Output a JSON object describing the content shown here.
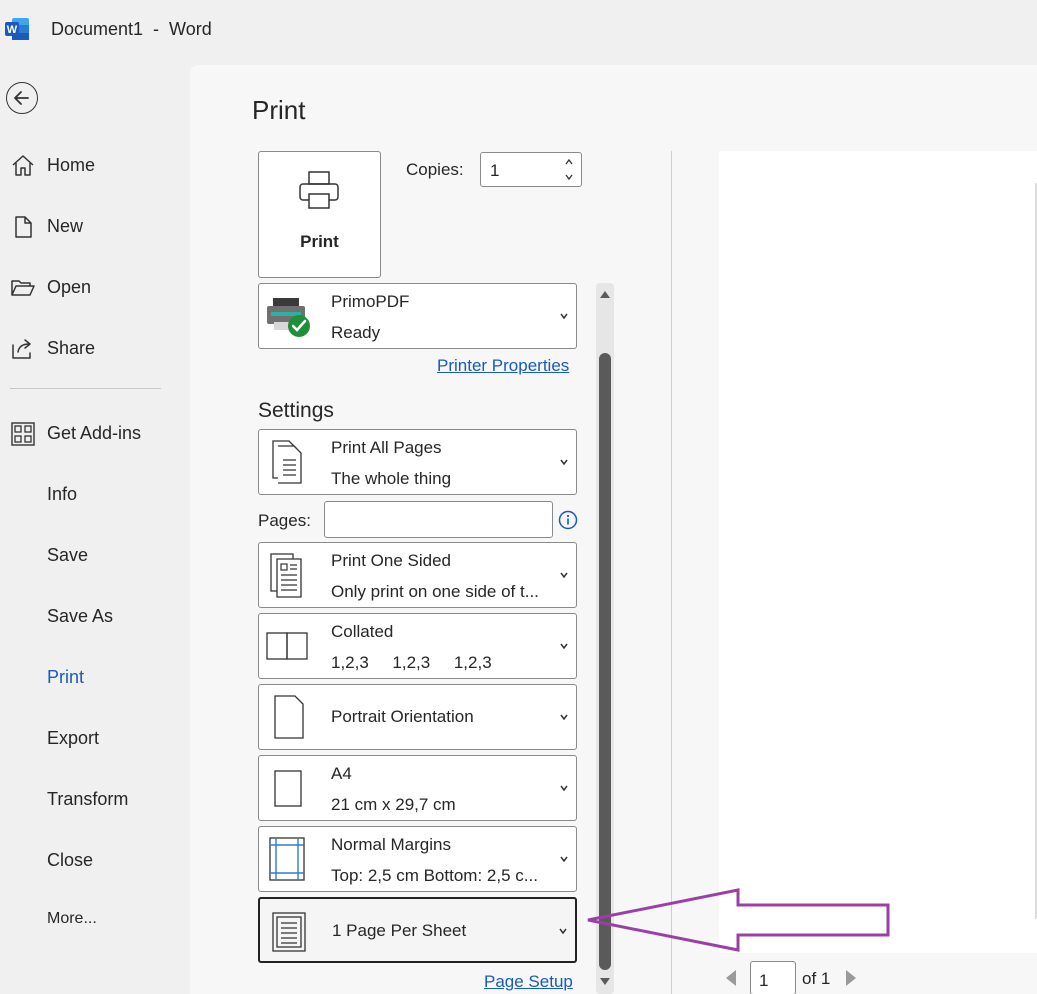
{
  "titlebar": {
    "title": "Document1  -  Word",
    "logo_letter": "W"
  },
  "nav": {
    "back_icon": "back-arrow-icon",
    "items": [
      {
        "label": "Home",
        "icon": "home-icon"
      },
      {
        "label": "New",
        "icon": "new-document-icon"
      },
      {
        "label": "Open",
        "icon": "folder-open-icon"
      },
      {
        "label": "Share",
        "icon": "share-icon"
      },
      {
        "label": "Get Add-ins",
        "icon": "add-ins-grid-icon"
      },
      {
        "label": "Info"
      },
      {
        "label": "Save"
      },
      {
        "label": "Save As"
      },
      {
        "label": "Print",
        "active": true
      },
      {
        "label": "Export"
      },
      {
        "label": "Transform"
      },
      {
        "label": "Close"
      },
      {
        "label": "More..."
      }
    ]
  },
  "print": {
    "heading": "Print",
    "print_button_label": "Print",
    "copies_label": "Copies:",
    "copies_value": "1",
    "printer": {
      "name": "PrimoPDF",
      "status": "Ready",
      "properties_link": "Printer Properties"
    },
    "settings_heading": "Settings",
    "pages_label": "Pages:",
    "pages_value": "",
    "settings": [
      {
        "line1": "Print All Pages",
        "line2": "The whole thing",
        "icon": "pages-icon"
      },
      {
        "line1": "Print One Sided",
        "line2": "Only print on one side of t...",
        "icon": "one-sided-icon"
      },
      {
        "line1": "Collated",
        "line2": "1,2,3     1,2,3     1,2,3",
        "icon": "collated-icon"
      },
      {
        "line1": "Portrait Orientation",
        "line2": "",
        "icon": "portrait-icon"
      },
      {
        "line1": "A4",
        "line2": "21 cm x 29,7 cm",
        "icon": "paper-size-icon"
      },
      {
        "line1": "Normal Margins",
        "line2": "Top: 2,5 cm Bottom: 2,5 c...",
        "icon": "margins-icon"
      },
      {
        "line1": "1 Page Per Sheet",
        "line2": "",
        "icon": "page-per-sheet-icon",
        "selected": true
      }
    ],
    "page_setup_link": "Page Setup"
  },
  "preview": {
    "current_page": "1",
    "of_text": "of 1"
  },
  "colors": {
    "accent": "#185abd",
    "annotation_arrow": "#9b3fa6"
  }
}
